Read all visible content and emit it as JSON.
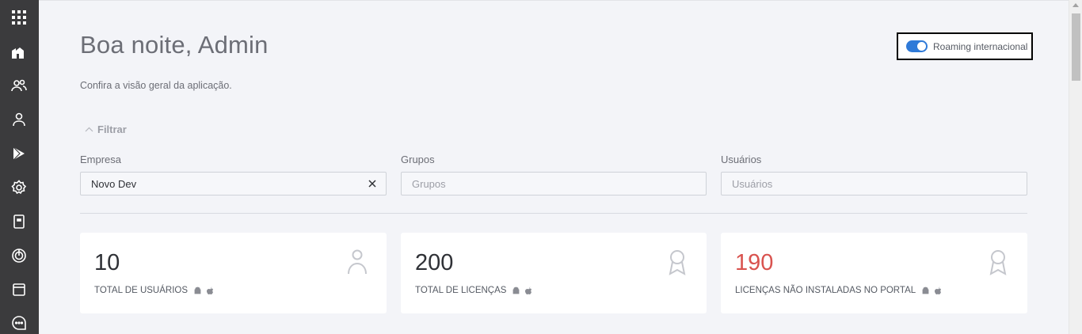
{
  "sidebar": {
    "icons": [
      "apps-grid-icon",
      "dashboard-icon",
      "groups-icon",
      "user-icon",
      "play-store-icon",
      "settings-icon",
      "device-icon",
      "radar-icon",
      "window-icon",
      "chat-icon"
    ]
  },
  "header": {
    "greeting": "Boa noite, Admin",
    "subtitle": "Confira a visão geral da aplicação."
  },
  "roaming": {
    "label": "Roaming internacional",
    "enabled": true
  },
  "filter": {
    "toggle_label": "Filtrar",
    "fields": [
      {
        "label": "Empresa",
        "value": "Novo Dev",
        "placeholder": ""
      },
      {
        "label": "Grupos",
        "value": "",
        "placeholder": "Grupos"
      },
      {
        "label": "Usuários",
        "value": "",
        "placeholder": "Usuários"
      }
    ]
  },
  "cards": [
    {
      "number": "10",
      "label": "TOTAL DE USUÁRIOS",
      "icon": "user-icon"
    },
    {
      "number": "200",
      "label": "TOTAL DE LICENÇAS",
      "icon": "award-icon"
    },
    {
      "number": "190",
      "label": "LICENÇAS NÃO INSTALADAS NO PORTAL",
      "icon": "award-icon",
      "highlight": true
    }
  ],
  "colors": {
    "sidebar": "#3b3b3d",
    "accent": "#2f7ad8",
    "danger": "#d9534f",
    "background": "#f3f4f8"
  }
}
